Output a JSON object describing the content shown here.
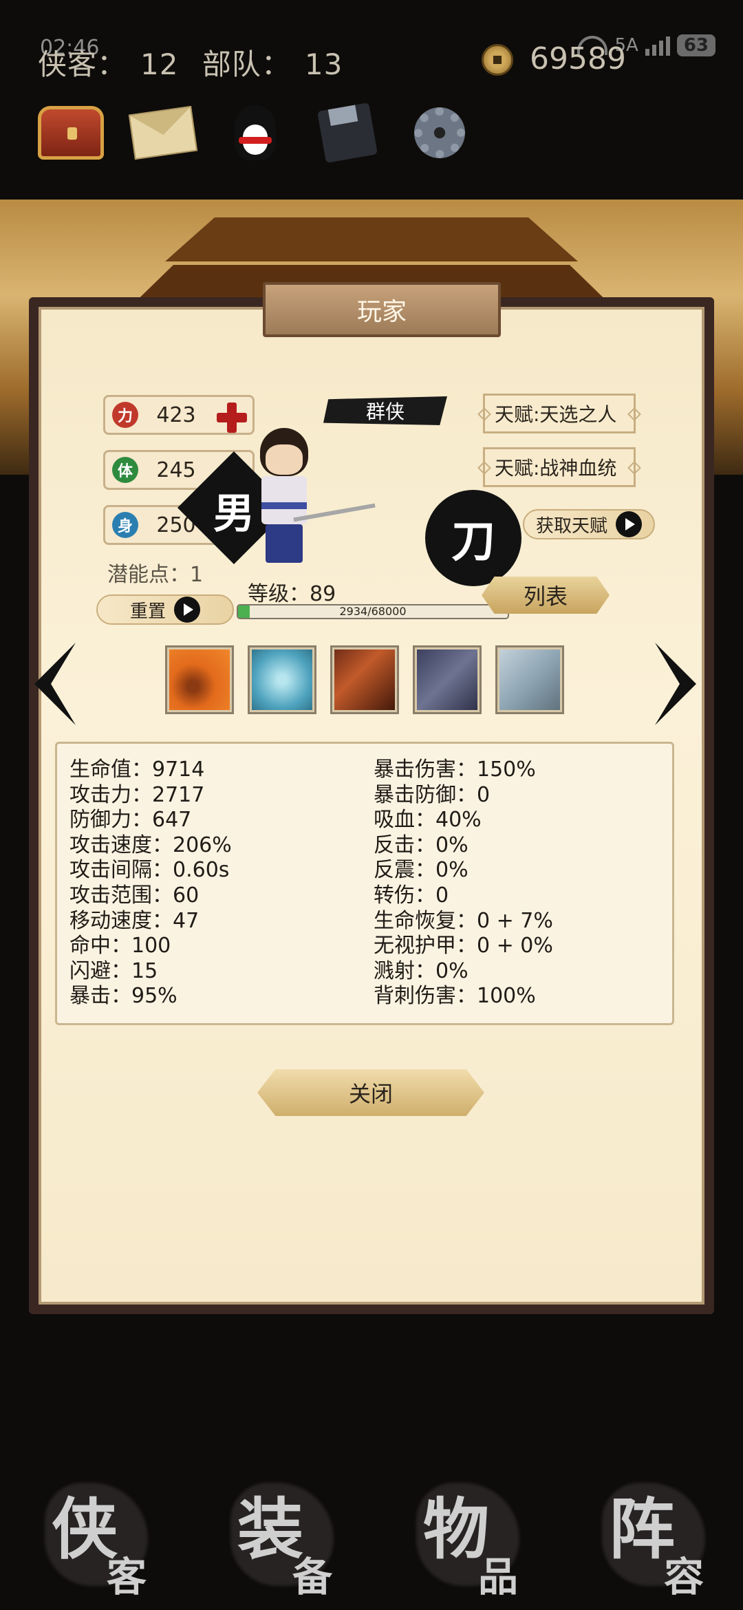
{
  "status": {
    "clock": "02:46",
    "network": "5A",
    "battery": "63"
  },
  "header": {
    "heroes_label": "侠客：",
    "heroes_count": "12",
    "troops_label": "部队：",
    "troops_count": "13",
    "gold": "69589"
  },
  "toolbar": {
    "icons": [
      "treasure-chest-icon",
      "mail-icon",
      "qq-penguin-icon",
      "save-disk-icon",
      "settings-gear-icon"
    ]
  },
  "dialog": {
    "title": "玩家",
    "attributes": [
      {
        "emblem": "力",
        "color": "#c0392b",
        "value": "423"
      },
      {
        "emblem": "体",
        "color": "#2e8b3e",
        "value": "245"
      },
      {
        "emblem": "身",
        "color": "#2b7fb0",
        "value": "250"
      }
    ],
    "potential_label": "潜能点：",
    "potential_value": "1",
    "reset_label": "重置",
    "title_banner": "群侠",
    "gender": "男",
    "weapon": "刀",
    "talents": [
      "天赋:天选之人",
      "天赋:战神血统"
    ],
    "get_talent_label": "获取天赋",
    "level_label": "等级：",
    "level_value": "89",
    "xp_text": "2934/68000",
    "xp_fraction": 0.043,
    "list_label": "列表",
    "close_label": "关闭"
  },
  "stats_left": [
    {
      "label": "生命值",
      "value": "9714"
    },
    {
      "label": "攻击力",
      "value": "2717"
    },
    {
      "label": "防御力",
      "value": "647"
    },
    {
      "label": "攻击速度",
      "value": "206%"
    },
    {
      "label": "攻击间隔",
      "value": "0.60s"
    },
    {
      "label": "攻击范围",
      "value": "60"
    },
    {
      "label": "移动速度",
      "value": "47"
    },
    {
      "label": "命中",
      "value": "100"
    },
    {
      "label": "闪避",
      "value": "15"
    },
    {
      "label": "暴击",
      "value": "95%"
    }
  ],
  "stats_right": [
    {
      "label": "暴击伤害",
      "value": "150%"
    },
    {
      "label": "暴击防御",
      "value": "0"
    },
    {
      "label": "吸血",
      "value": "40%"
    },
    {
      "label": "反击",
      "value": "0%"
    },
    {
      "label": "反震",
      "value": "0%"
    },
    {
      "label": "转伤",
      "value": "0"
    },
    {
      "label": "生命恢复",
      "value": "0 + 7%"
    },
    {
      "label": "无视护甲",
      "value": "0 + 0%"
    },
    {
      "label": "溅射",
      "value": "0%"
    },
    {
      "label": "背刺伤害",
      "value": "100%"
    }
  ],
  "bottom_nav": [
    {
      "big": "侠",
      "small": "客"
    },
    {
      "big": "装",
      "small": "备"
    },
    {
      "big": "物",
      "small": "品"
    },
    {
      "big": "阵",
      "small": "容"
    }
  ]
}
